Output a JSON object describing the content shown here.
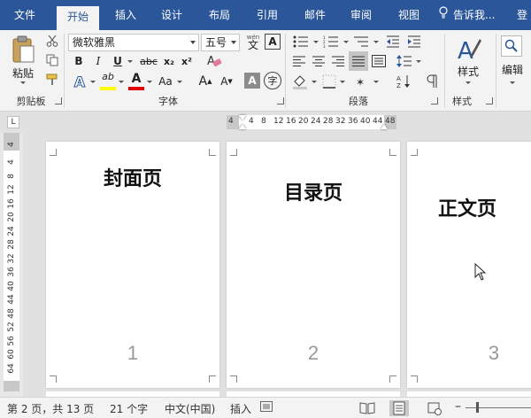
{
  "ribbon_tabs": {
    "file": "文件",
    "home": "开始",
    "insert": "插入",
    "design": "设计",
    "layout": "布局",
    "references": "引用",
    "mailings": "邮件",
    "review": "审阅",
    "view": "视图",
    "tell_me": "告诉我...",
    "signin": "登"
  },
  "clipboard": {
    "paste_label": "粘贴",
    "group_label": "剪贴板"
  },
  "font": {
    "font_name": "微软雅黑",
    "font_size": "五号",
    "wen_label": "wén",
    "wen_char": "文",
    "A_box": "A",
    "bold": "B",
    "italic": "I",
    "underline": "U",
    "strike": "abc",
    "subscript": "x₂",
    "superscript": "x²",
    "effects": "A",
    "highlight": "ab",
    "color_A": "A",
    "aa": "Aa",
    "grow": "A",
    "shrink": "A",
    "shade_A": "A",
    "enclose": "字",
    "group_label": "字体",
    "highlight_color": "#ffff00",
    "font_color": "#e00000"
  },
  "paragraph": {
    "group_label": "段落"
  },
  "styles": {
    "label": "样式",
    "group_label": "样式"
  },
  "editing": {
    "label": "编辑"
  },
  "ruler": {
    "corner": "L",
    "h_ticks": [
      "4",
      "4",
      "8",
      "12",
      "16",
      "20",
      "24",
      "28",
      "32",
      "36",
      "40",
      "44",
      "48"
    ],
    "v_ticks": [
      "4",
      "4",
      "8",
      "12",
      "16",
      "20",
      "24",
      "28",
      "32",
      "36",
      "40",
      "44",
      "48",
      "52",
      "56",
      "60",
      "64"
    ]
  },
  "pages": [
    {
      "title": "封面页",
      "number": "1"
    },
    {
      "title": "目录页",
      "number": "2"
    },
    {
      "title": "正文页",
      "number": "3"
    }
  ],
  "status": {
    "page": "第 2 页，共 13 页",
    "words": "21 个字",
    "language": "中文(中国)",
    "mode": "插入"
  },
  "colors": {
    "brand": "#2b579a"
  }
}
